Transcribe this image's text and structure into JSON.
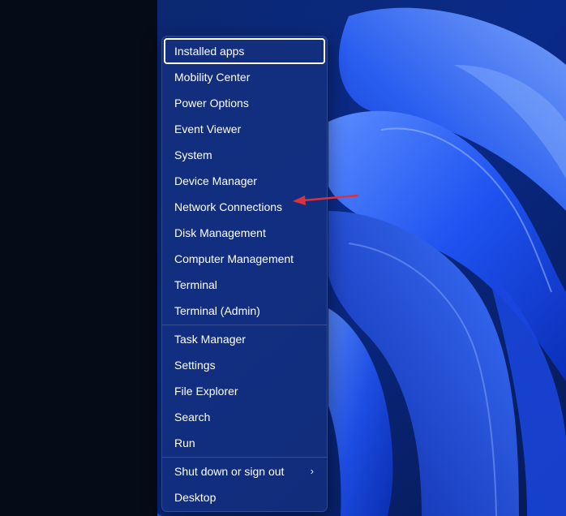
{
  "menu": {
    "group1": [
      {
        "label": "Installed apps"
      },
      {
        "label": "Mobility Center"
      },
      {
        "label": "Power Options"
      },
      {
        "label": "Event Viewer"
      },
      {
        "label": "System"
      },
      {
        "label": "Device Manager"
      },
      {
        "label": "Network Connections"
      },
      {
        "label": "Disk Management"
      },
      {
        "label": "Computer Management"
      },
      {
        "label": "Terminal"
      },
      {
        "label": "Terminal (Admin)"
      }
    ],
    "group2": [
      {
        "label": "Task Manager"
      },
      {
        "label": "Settings"
      },
      {
        "label": "File Explorer"
      },
      {
        "label": "Search"
      },
      {
        "label": "Run"
      }
    ],
    "group3": [
      {
        "label": "Shut down or sign out",
        "submenu_glyph": "›"
      },
      {
        "label": "Desktop"
      }
    ]
  },
  "colors": {
    "menu_background": "#14307e",
    "left_pane": "#050b17",
    "annotation_arrow": "#d9333b"
  },
  "icons": {
    "submenu": "chevron-right-icon",
    "annotation": "red-arrow-icon"
  }
}
